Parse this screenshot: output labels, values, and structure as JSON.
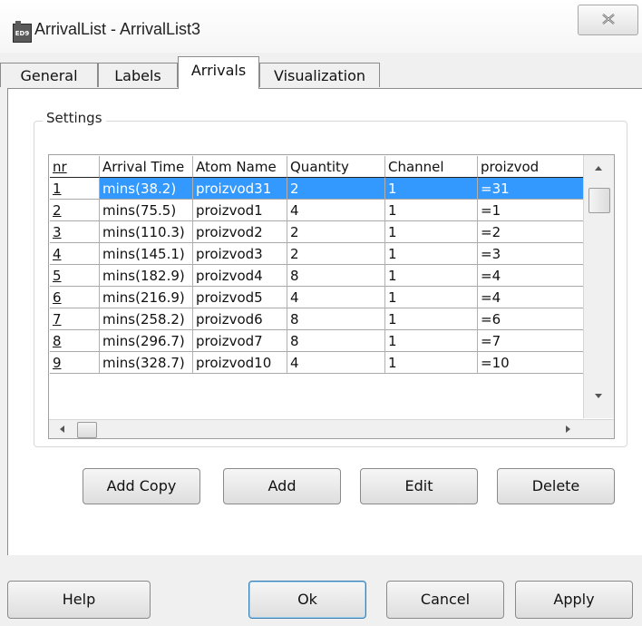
{
  "window": {
    "icon_label": "ED9",
    "title": "ArrivalList - ArrivalList3"
  },
  "tabs": [
    {
      "label": "General",
      "active": false
    },
    {
      "label": "Labels",
      "active": false
    },
    {
      "label": "Arrivals",
      "active": true
    },
    {
      "label": "Visualization",
      "active": false
    }
  ],
  "settings": {
    "legend": "Settings",
    "table": {
      "columns": [
        "nr",
        "Arrival Time",
        "Atom Name",
        "Quantity",
        "Channel",
        "proizvod"
      ],
      "rows": [
        {
          "nr": "1",
          "arrival_time": "mins(38.2)",
          "atom_name": "proizvod31",
          "quantity": "2",
          "channel": "1",
          "proizvod": "=31",
          "selected": true
        },
        {
          "nr": "2",
          "arrival_time": "mins(75.5)",
          "atom_name": "proizvod1",
          "quantity": "4",
          "channel": "1",
          "proizvod": "=1"
        },
        {
          "nr": "3",
          "arrival_time": "mins(110.3)",
          "atom_name": "proizvod2",
          "quantity": "2",
          "channel": "1",
          "proizvod": "=2"
        },
        {
          "nr": "4",
          "arrival_time": "mins(145.1)",
          "atom_name": "proizvod3",
          "quantity": "2",
          "channel": "1",
          "proizvod": "=3"
        },
        {
          "nr": "5",
          "arrival_time": "mins(182.9)",
          "atom_name": "proizvod4",
          "quantity": "8",
          "channel": "1",
          "proizvod": "=4"
        },
        {
          "nr": "6",
          "arrival_time": "mins(216.9)",
          "atom_name": "proizvod5",
          "quantity": "4",
          "channel": "1",
          "proizvod": "=4"
        },
        {
          "nr": "7",
          "arrival_time": "mins(258.2)",
          "atom_name": "proizvod6",
          "quantity": "8",
          "channel": "1",
          "proizvod": "=6"
        },
        {
          "nr": "8",
          "arrival_time": "mins(296.7)",
          "atom_name": "proizvod7",
          "quantity": "8",
          "channel": "1",
          "proizvod": "=7"
        },
        {
          "nr": "9",
          "arrival_time": "mins(328.7)",
          "atom_name": "proizvod10",
          "quantity": "4",
          "channel": "1",
          "proizvod": "=10"
        }
      ]
    },
    "buttons": {
      "add_copy": "Add Copy",
      "add": "Add",
      "edit": "Edit",
      "delete": "Delete"
    }
  },
  "footer": {
    "help": "Help",
    "ok": "Ok",
    "cancel": "Cancel",
    "apply": "Apply"
  },
  "colors": {
    "selection": "#3399ff",
    "default_button_border": "#3c7fb1"
  }
}
